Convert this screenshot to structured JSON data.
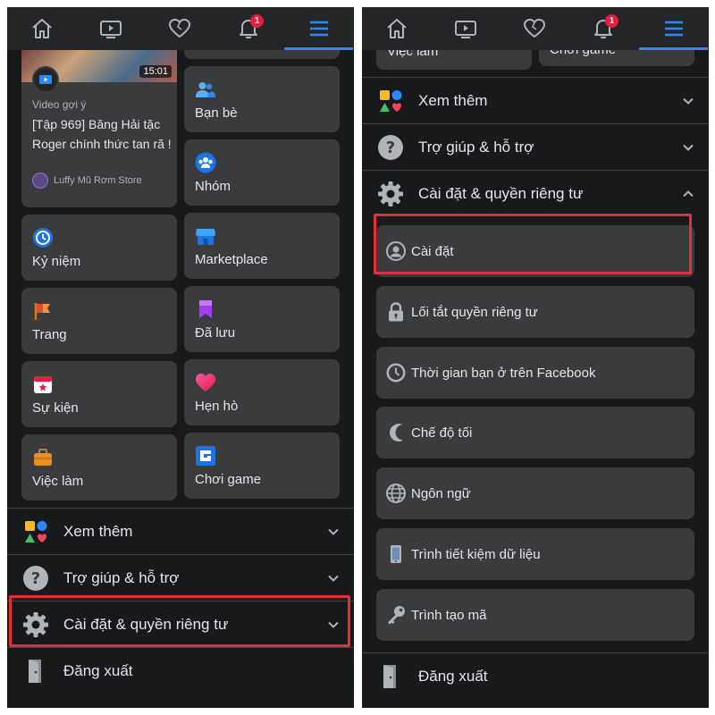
{
  "colors": {
    "background": "#18191a",
    "card": "#3a3b3c",
    "accent": "#2d88ff",
    "highlight": "#e0303f",
    "badge": "#e41e3f"
  },
  "nav": {
    "items": [
      {
        "icon": "home-icon"
      },
      {
        "icon": "video-icon"
      },
      {
        "icon": "heart-icon"
      },
      {
        "icon": "bell-icon",
        "badge": "1"
      },
      {
        "icon": "menu-icon",
        "active": true
      }
    ]
  },
  "left": {
    "video": {
      "duration": "15:01",
      "kicker": "Video gợi ý",
      "title": "[Tập 969] Băng Hải tặc Roger chính thức tan rã !",
      "channel": "Luffy Mũ Rơm Store"
    },
    "shortcuts_left": [
      {
        "label": "Kỷ niệm",
        "icon": "memories-icon"
      },
      {
        "label": "Trang",
        "icon": "pages-icon"
      },
      {
        "label": "Sự kiện",
        "icon": "events-icon"
      },
      {
        "label": "Việc làm",
        "icon": "jobs-icon"
      }
    ],
    "shortcuts_right": [
      {
        "label": "Bạn bè",
        "icon": "friends-icon"
      },
      {
        "label": "Nhóm",
        "icon": "groups-icon"
      },
      {
        "label": "Marketplace",
        "icon": "marketplace-icon"
      },
      {
        "label": "Đã lưu",
        "icon": "saved-icon"
      },
      {
        "label": "Hẹn hò",
        "icon": "dating-icon"
      },
      {
        "label": "Chơi game",
        "icon": "gaming-icon"
      }
    ],
    "sections": [
      {
        "label": "Xem thêm",
        "icon": "see-more-icon"
      },
      {
        "label": "Trợ giúp & hỗ trợ",
        "icon": "help-icon"
      },
      {
        "label": "Cài đặt & quyền riêng tư",
        "icon": "settings-gear-icon"
      },
      {
        "label": "Đăng xuất",
        "icon": "logout-icon"
      }
    ]
  },
  "right": {
    "partial_tiles": [
      "Việc làm",
      "Chơi game"
    ],
    "sections": [
      {
        "label": "Xem thêm",
        "icon": "see-more-icon"
      },
      {
        "label": "Trợ giúp & hỗ trợ",
        "icon": "help-icon"
      },
      {
        "label": "Cài đặt & quyền riêng tư",
        "icon": "settings-gear-icon",
        "expanded": true
      }
    ],
    "settings_items": [
      {
        "label": "Cài đặt",
        "icon": "profile-settings-icon"
      },
      {
        "label": "Lối tắt quyền riêng tư",
        "icon": "lock-icon"
      },
      {
        "label": "Thời gian bạn ở trên Facebook",
        "icon": "clock-icon"
      },
      {
        "label": "Chế độ tối",
        "icon": "moon-icon"
      },
      {
        "label": "Ngôn ngữ",
        "icon": "globe-icon"
      },
      {
        "label": "Trình tiết kiệm dữ liệu",
        "icon": "phone-icon"
      },
      {
        "label": "Trình tạo mã",
        "icon": "key-icon"
      }
    ],
    "logout": {
      "label": "Đăng xuất",
      "icon": "logout-icon"
    }
  }
}
